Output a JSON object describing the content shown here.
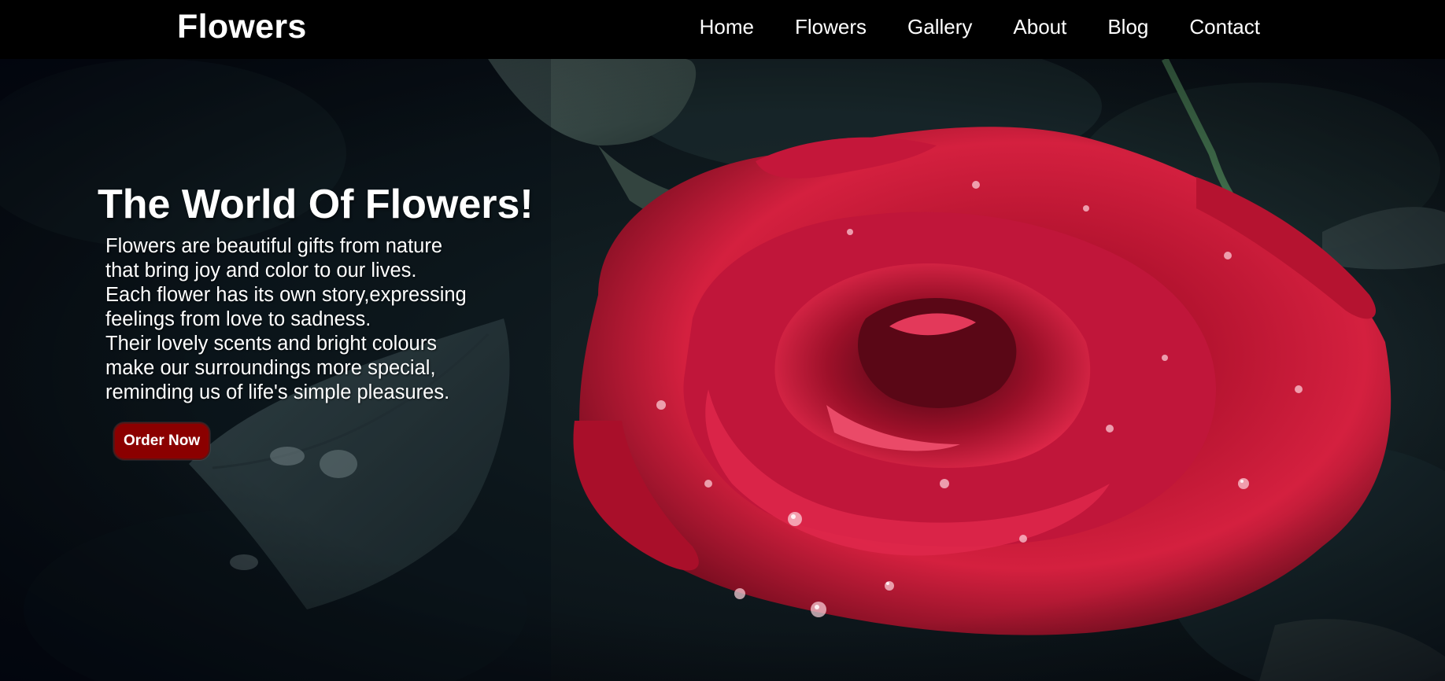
{
  "header": {
    "brand": "Flowers",
    "nav": [
      {
        "label": "Home"
      },
      {
        "label": "Flowers"
      },
      {
        "label": "Gallery"
      },
      {
        "label": "About"
      },
      {
        "label": "Blog"
      },
      {
        "label": "Contact"
      }
    ]
  },
  "hero": {
    "title": "The World Of Flowers!",
    "lines": [
      "Flowers are beautiful gifts from nature",
      "that bring joy and color to our lives.",
      "Each flower has its own story,expressing",
      "feelings from love to sadness.",
      "Their lovely scents and bright colours",
      "make our surroundings more special,",
      "reminding us of life's simple pleasures."
    ],
    "button_label": "Order Now",
    "image_subject": "red-rose-with-water-drops"
  },
  "colors": {
    "navbar": "#000000",
    "button": "#8b0000",
    "rose": "#c8102e",
    "background": "#0f1a1e"
  }
}
